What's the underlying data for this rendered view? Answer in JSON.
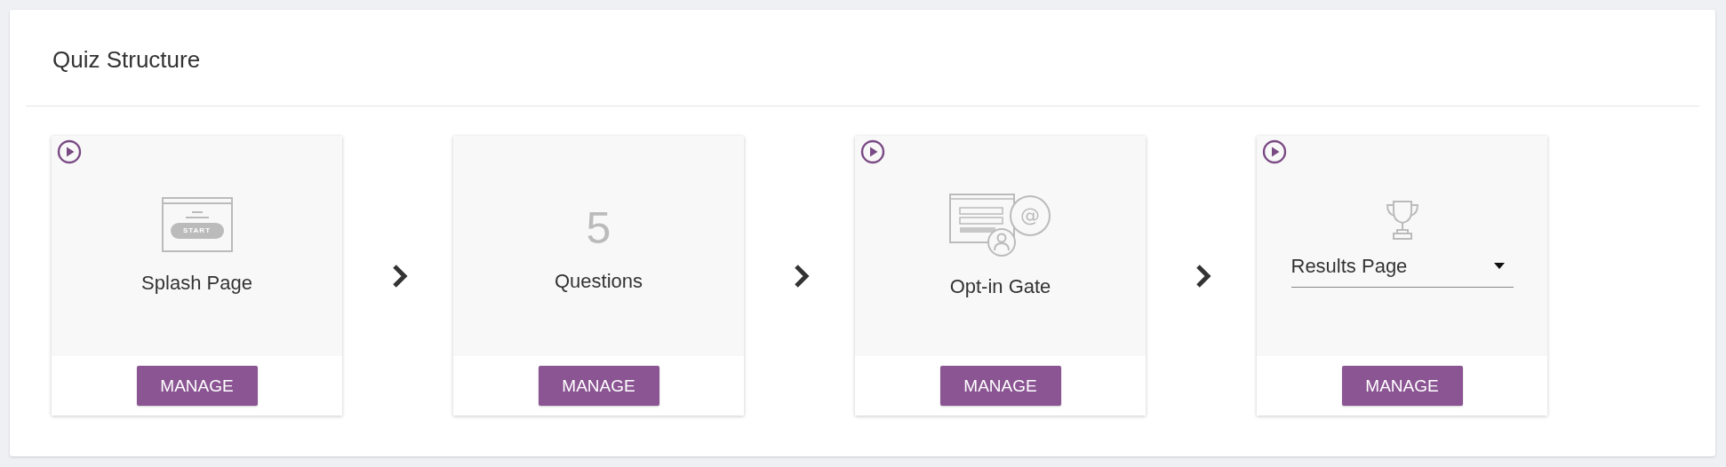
{
  "panel": {
    "title": "Quiz Structure"
  },
  "steps": [
    {
      "kind": "splash",
      "preview": true,
      "icon_text": "START",
      "label": "Splash Page",
      "button": "MANAGE"
    },
    {
      "kind": "count",
      "preview": false,
      "count": "5",
      "label": "Questions",
      "button": "MANAGE"
    },
    {
      "kind": "optin",
      "preview": true,
      "icon_text": "@",
      "label": "Opt-in Gate",
      "button": "MANAGE"
    },
    {
      "kind": "results",
      "preview": true,
      "select": {
        "value": "Results Page"
      },
      "button": "MANAGE"
    }
  ]
}
